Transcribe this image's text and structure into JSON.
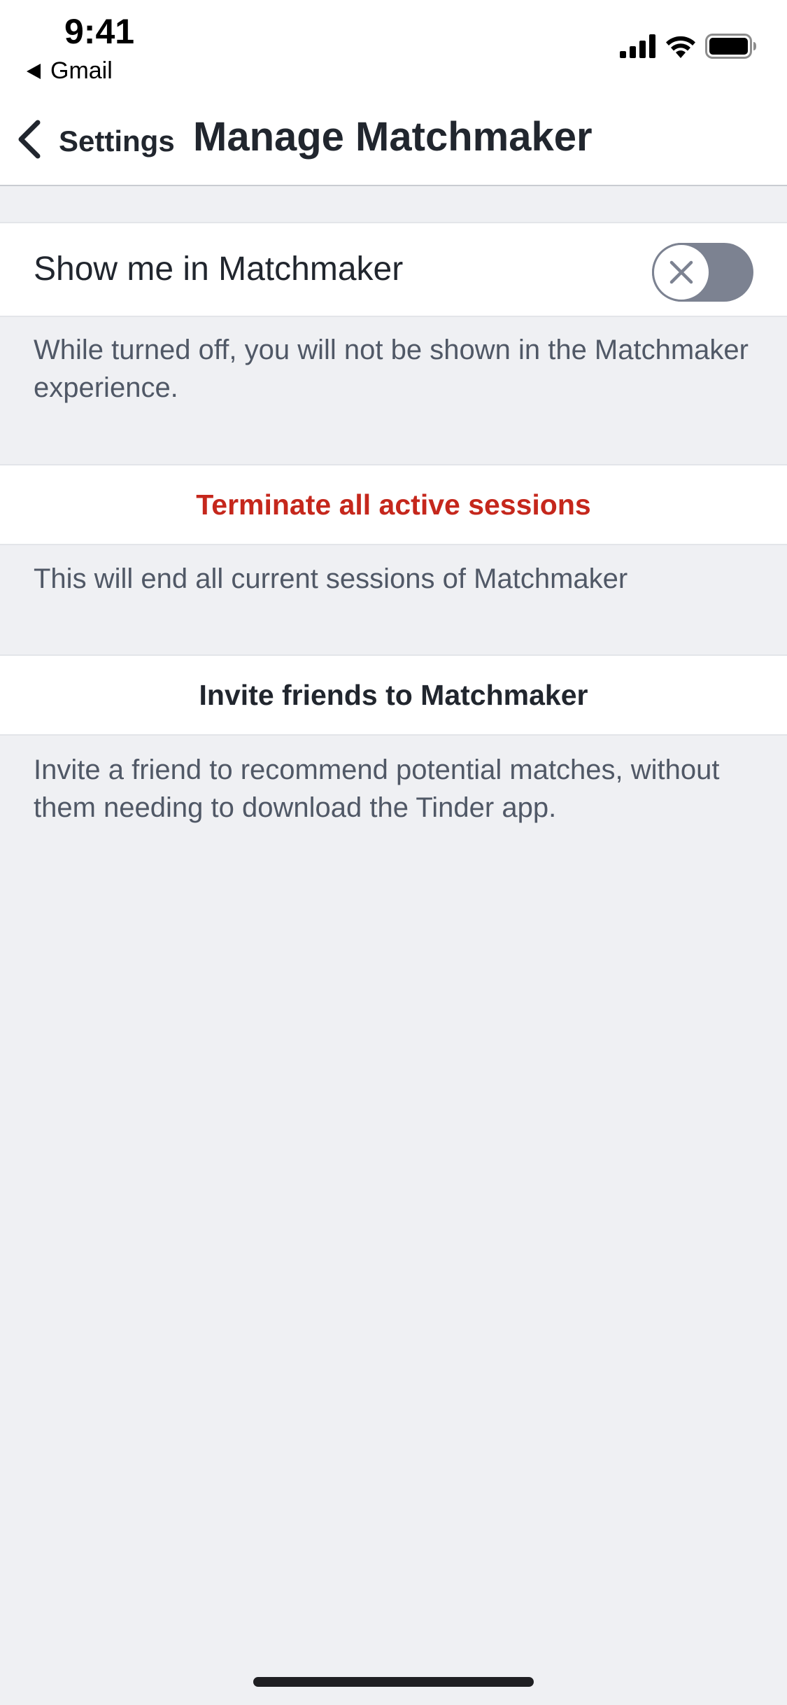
{
  "status_bar": {
    "time": "9:41",
    "back_app_label": "Gmail",
    "icons": [
      "cellular-signal-icon",
      "wifi-icon",
      "battery-icon"
    ]
  },
  "nav": {
    "back_label": "Settings",
    "title": "Manage Matchmaker",
    "back_icon": "chevron-left-icon"
  },
  "show_in_matchmaker": {
    "label": "Show me in Matchmaker",
    "enabled": false,
    "toggle_icon": "close-icon",
    "note": "While turned off, you will not be shown in the Matchmaker experience."
  },
  "terminate_sessions": {
    "label": "Terminate all active sessions",
    "note": "This will end all current sessions of Matchmaker",
    "color": "#c5271c"
  },
  "invite_friends": {
    "label": "Invite friends to Matchmaker",
    "note": "Invite a friend to recommend potential matches, without them needing to download the Tinder app."
  },
  "colors": {
    "background": "#eff0f3",
    "surface": "#ffffff",
    "text_primary": "#21262e",
    "text_secondary": "#505866",
    "toggle_off": "#7c8291"
  }
}
